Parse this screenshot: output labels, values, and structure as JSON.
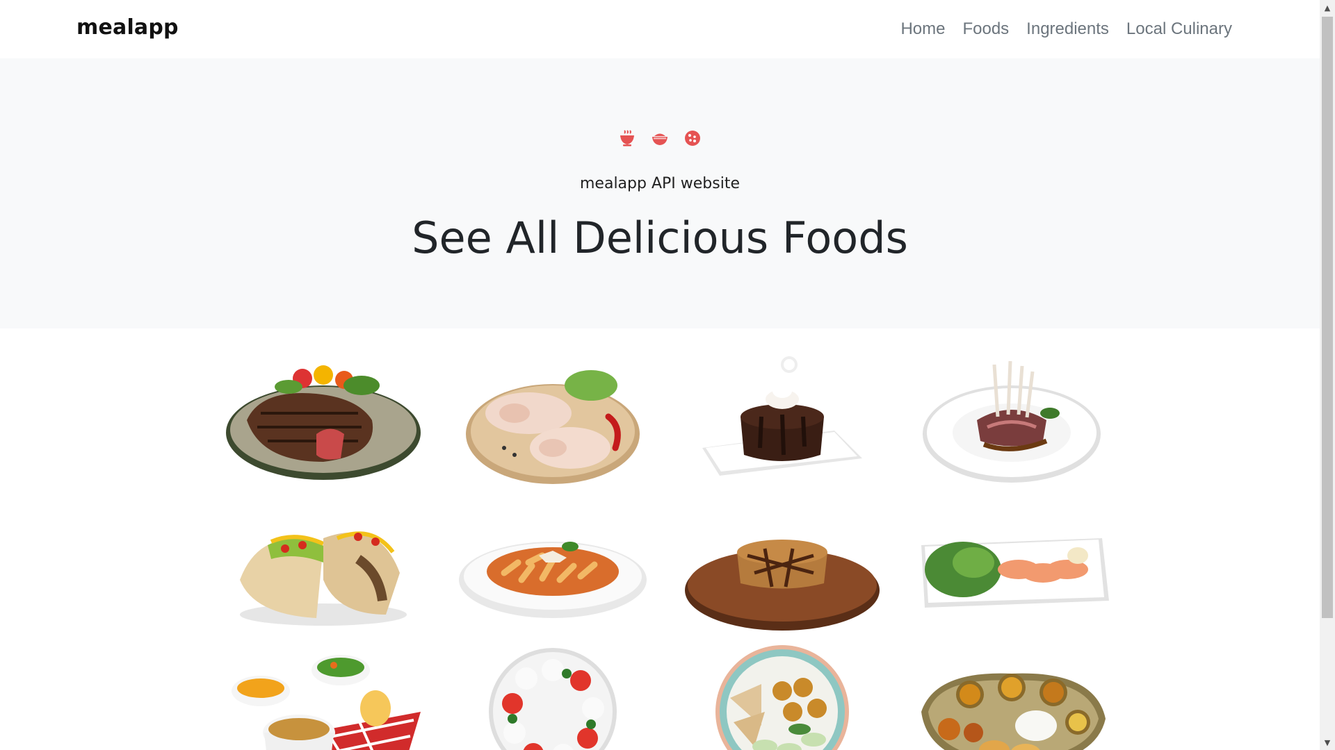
{
  "navbar": {
    "brand": "mealapp",
    "links": [
      "Home",
      "Foods",
      "Ingredients",
      "Local Culinary"
    ]
  },
  "hero": {
    "icons": [
      "mug-hot-icon",
      "bowl-icon",
      "cookie-icon"
    ],
    "subtitle": "mealapp API website",
    "title": "See All Delicious Foods"
  },
  "foods": [
    {
      "name": "steak-plate"
    },
    {
      "name": "raw-chicken-legs"
    },
    {
      "name": "chocolate-lava-cake"
    },
    {
      "name": "lamb-rack"
    },
    {
      "name": "tacos"
    },
    {
      "name": "penne-bolognese"
    },
    {
      "name": "grilled-pork-chop"
    },
    {
      "name": "salmon-sashimi-salad"
    },
    {
      "name": "side-dish-bowls"
    },
    {
      "name": "caprese-wreath"
    },
    {
      "name": "pita-falafel-bowl"
    },
    {
      "name": "indian-thali"
    }
  ],
  "colors": {
    "accent": "#e55353",
    "hero_bg": "#f8f9fa",
    "nav_link": "#6c757d"
  }
}
